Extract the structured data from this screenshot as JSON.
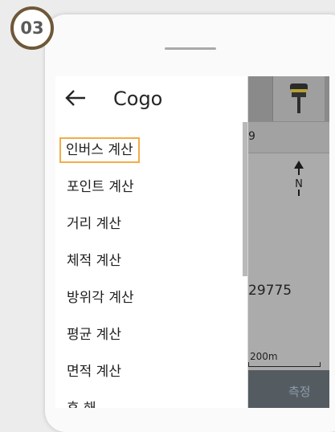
{
  "step_badge": "03",
  "drawer": {
    "title": "Cogo",
    "back_icon": "arrow-left-icon",
    "items": [
      {
        "label": "인버스 계산",
        "selected": true
      },
      {
        "label": "포인트 계산"
      },
      {
        "label": "거리 계산"
      },
      {
        "label": "체적 계산"
      },
      {
        "label": "방위각 계산"
      },
      {
        "label": "평균 계산"
      },
      {
        "label": "면적 계산"
      },
      {
        "label": "후 해"
      }
    ]
  },
  "map": {
    "row_value": "9",
    "north_label": "N",
    "coordinate_value": "29775",
    "scale_label": "200m",
    "measure_button": "측정",
    "device_icon": "gnss-receiver-icon"
  },
  "colors": {
    "badge_ring": "#6e5838",
    "selection_outline": "#f3ac47",
    "bottom_bar": "#555c61",
    "measure_text": "#8a9cad"
  }
}
